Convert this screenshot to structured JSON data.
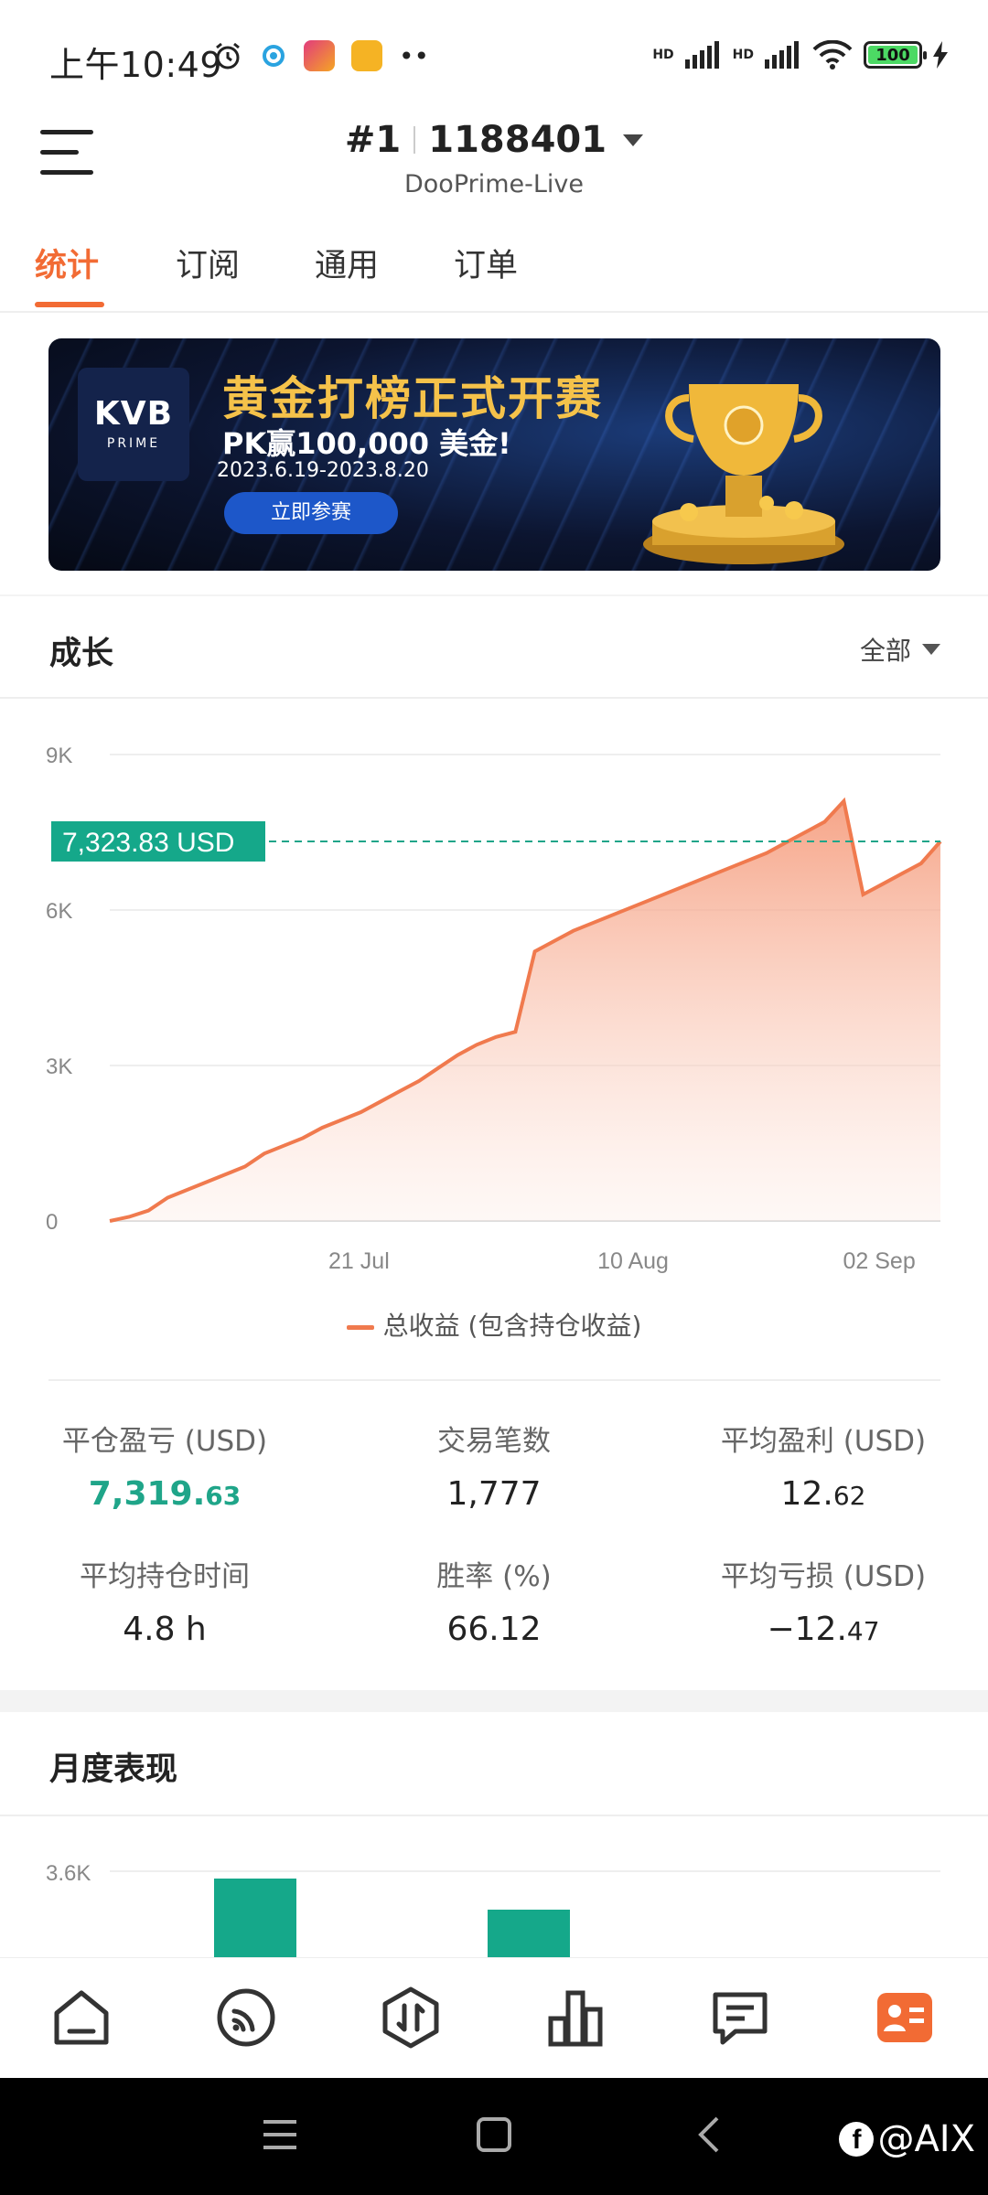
{
  "status_bar": {
    "time": "上午10:49",
    "battery": "100",
    "signal_label_1": "HD",
    "signal_label_2": "HD"
  },
  "header": {
    "rank": "#1",
    "account_id": "1188401",
    "server": "DooPrime-Live"
  },
  "tabs": [
    {
      "label": "统计",
      "active": true
    },
    {
      "label": "订阅",
      "active": false
    },
    {
      "label": "通用",
      "active": false
    },
    {
      "label": "订单",
      "active": false
    }
  ],
  "banner": {
    "logo_main": "KVB",
    "logo_sub": "PRIME",
    "title": "黄金打榜正式开赛",
    "subtitle": "PK赢100,000 美金!",
    "date_range": "2023.6.19-2023.8.20",
    "cta": "立即参赛"
  },
  "growth": {
    "title": "成长",
    "filter": "全部",
    "legend": "总收益 (包含持仓收益)"
  },
  "chart_data": {
    "type": "area",
    "x_ticks": [
      "21 Jul",
      "10 Aug",
      "02 Sep"
    ],
    "y_ticks": [
      "0",
      "3K",
      "6K",
      "9K"
    ],
    "ylim": [
      0,
      9000
    ],
    "current_value_label": "7,323.83 USD",
    "current_value": 7323.83,
    "series": [
      {
        "name": "总收益 (包含持仓收益)",
        "color": "#f07a4e",
        "values": [
          0,
          80,
          200,
          450,
          600,
          750,
          900,
          1050,
          1300,
          1450,
          1600,
          1800,
          1950,
          2100,
          2300,
          2500,
          2700,
          2950,
          3200,
          3400,
          3550,
          3650,
          5200,
          5400,
          5600,
          5750,
          5900,
          6050,
          6200,
          6350,
          6500,
          6650,
          6800,
          6950,
          7100,
          7300,
          7500,
          7700,
          8100,
          6300,
          6500,
          6700,
          6900,
          7324
        ]
      }
    ]
  },
  "stats": [
    {
      "label": "平仓盈亏 (USD)",
      "value_main": "7,319.",
      "value_dec": "63",
      "style": "green"
    },
    {
      "label": "交易笔数",
      "value_main": "1,777",
      "value_dec": "",
      "style": "normal"
    },
    {
      "label": "平均盈利 (USD)",
      "value_main": "12.",
      "value_dec": "62",
      "style": "normal"
    },
    {
      "label": "平均持仓时间",
      "value_main": "4.8 h",
      "value_dec": "",
      "style": "normal"
    },
    {
      "label": "胜率 (%)",
      "value_main": "66.12",
      "value_dec": "",
      "style": "normal"
    },
    {
      "label": "平均亏损 (USD)",
      "value_main": "−12.",
      "value_dec": "47",
      "style": "normal"
    }
  ],
  "monthly": {
    "title": "月度表现",
    "chart_data": {
      "type": "bar",
      "y_ticks": [
        "3.6K"
      ],
      "bars_visible": 2,
      "color": "#15a88a"
    }
  },
  "bottom_nav": [
    {
      "icon": "home-icon",
      "active": false
    },
    {
      "icon": "signal-icon",
      "active": false
    },
    {
      "icon": "trade-icon",
      "active": false
    },
    {
      "icon": "market-chart-icon",
      "active": false
    },
    {
      "icon": "message-icon",
      "active": false
    },
    {
      "icon": "profile-card-icon",
      "active": true
    }
  ],
  "watermark": "@AIX"
}
